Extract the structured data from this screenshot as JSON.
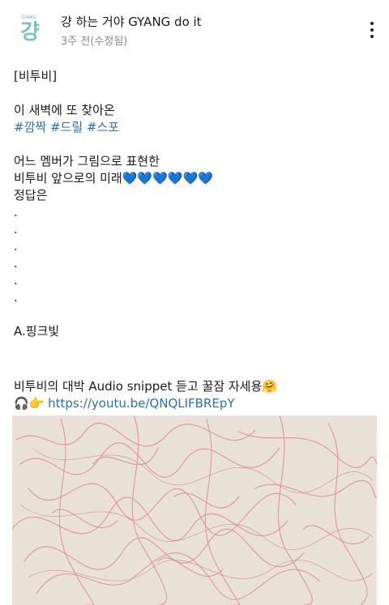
{
  "header": {
    "avatar_mini_text": "GYANG",
    "avatar_glyph": "걍",
    "author": "걍 하는 거야 GYANG do it",
    "time": "3주 전(수정됨)",
    "more_icon": "more-vertical-icon"
  },
  "post": {
    "line1": "[비투비]",
    "line2": "이 새벽에 또 찾아온",
    "hashtags": [
      "#깜짝",
      "#드릴",
      "#스포"
    ],
    "line4": "어느 멤버가 그림으로 표현한",
    "line5_text": "비투비 앞으로의 미래",
    "line5_hearts": "💙💙💙💙💙💙",
    "line6": "정답은",
    "dots": [
      ".",
      ".",
      ".",
      ".",
      ".",
      "."
    ],
    "answer": "A.핑크빛",
    "audio_text": "비투비의 대박 Audio snippet 듣고 꿀잠 자세용",
    "audio_emoji": "🤗",
    "link_emojis": "🎧👉",
    "link_url": "https://youtu.be/QNQLIFBREpY"
  },
  "image": {
    "alt": "crayon scribble drawing",
    "colors": {
      "paper": "#e9e0d6",
      "crayon": "#d98a96"
    }
  }
}
